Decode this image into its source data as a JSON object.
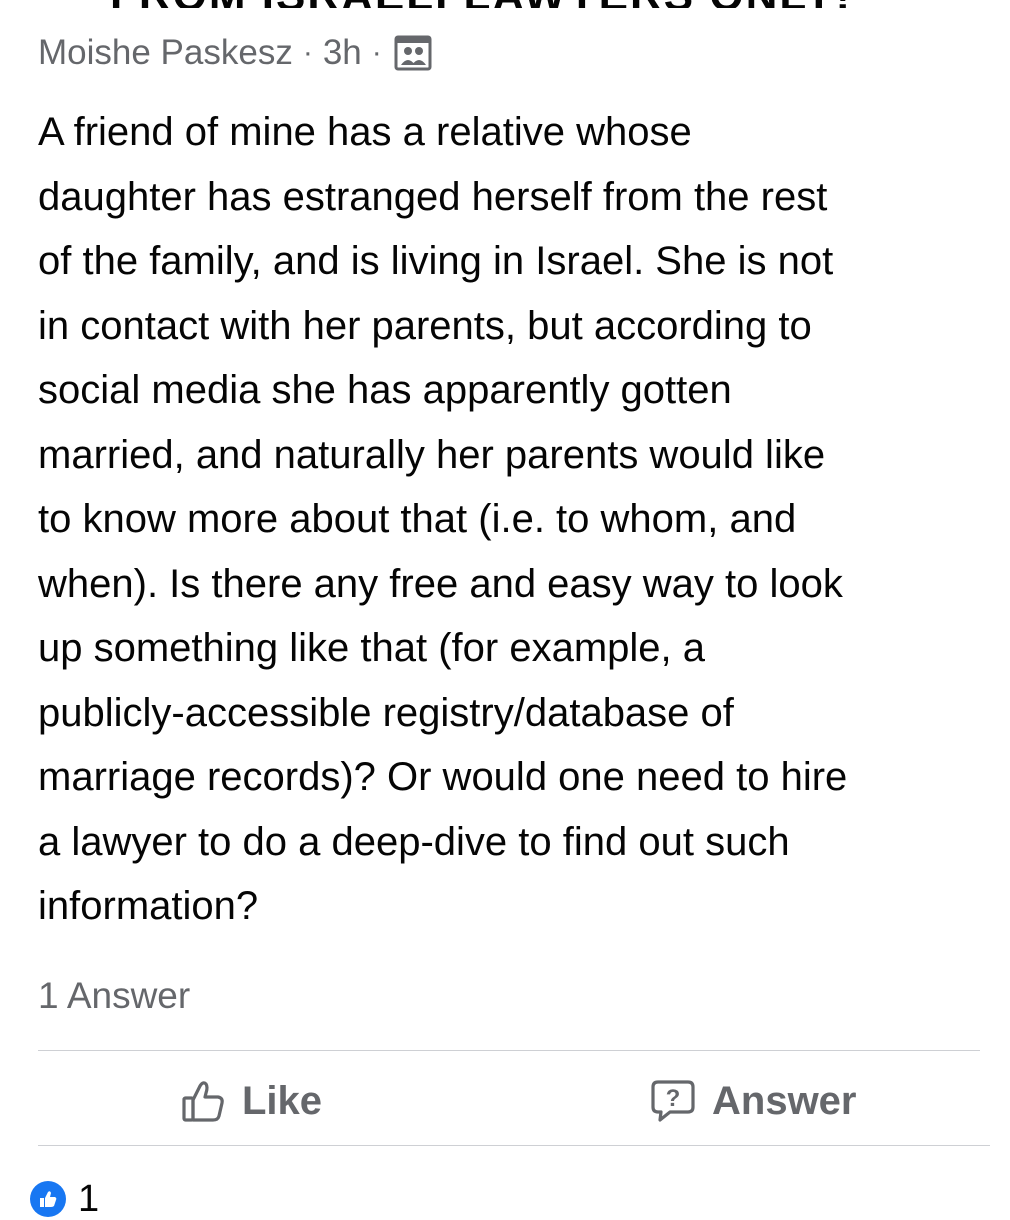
{
  "post": {
    "cut_title": "FROM ISRAELI LAWYERS ONLY!",
    "author": "Moishe Paskesz",
    "separator": "·",
    "time": "3h",
    "audience_icon": "group-icon",
    "body": "A friend of mine has a relative whose\ndaughter has estranged herself from the rest\nof the family, and is living in Israel. She is not\nin contact with her parents, but according to\nsocial media she has apparently gotten\nmarried, and naturally her parents would like\nto know more about that (i.e. to whom, and\nwhen). Is there any free and easy way to look\nup something like that (for example, a\npublicly-accessible registry/database of\nmarriage records)? Or would one need to hire\na lawyer to do a deep-dive to find out such\ninformation?",
    "answers_count_label": "1 Answer"
  },
  "actions": {
    "like_label": "Like",
    "like_icon": "thumbs-up-icon",
    "answer_label": "Answer",
    "answer_icon": "question-bubble-icon"
  },
  "reactions": {
    "icon": "like-badge-icon",
    "count": "1"
  },
  "colors": {
    "text": "#050505",
    "secondary": "#65676b",
    "divider": "#ced0d4",
    "like_blue": "#1877f2"
  }
}
